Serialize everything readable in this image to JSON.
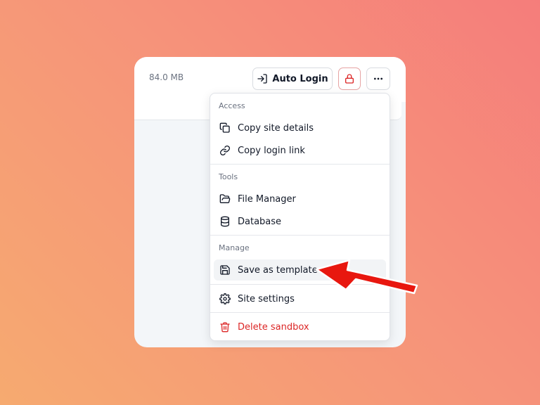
{
  "card": {
    "size": "84.0 MB",
    "auto_login_label": "Auto Login"
  },
  "menu": {
    "sections": [
      {
        "label": "Access",
        "items": [
          {
            "label": "Copy site details",
            "icon": "copy-icon"
          },
          {
            "label": "Copy login link",
            "icon": "link-icon"
          }
        ]
      },
      {
        "label": "Tools",
        "items": [
          {
            "label": "File Manager",
            "icon": "folder-open-icon"
          },
          {
            "label": "Database",
            "icon": "database-icon"
          }
        ]
      },
      {
        "label": "Manage",
        "items": [
          {
            "label": "Save as template",
            "icon": "save-icon",
            "highlighted": true
          }
        ]
      }
    ],
    "settings_label": "Site settings",
    "delete_label": "Delete sandbox"
  },
  "colors": {
    "danger": "#dc2626",
    "annotation_arrow": "#e8170f",
    "background_start": "#f57d7b",
    "background_end": "#f6aa70"
  }
}
